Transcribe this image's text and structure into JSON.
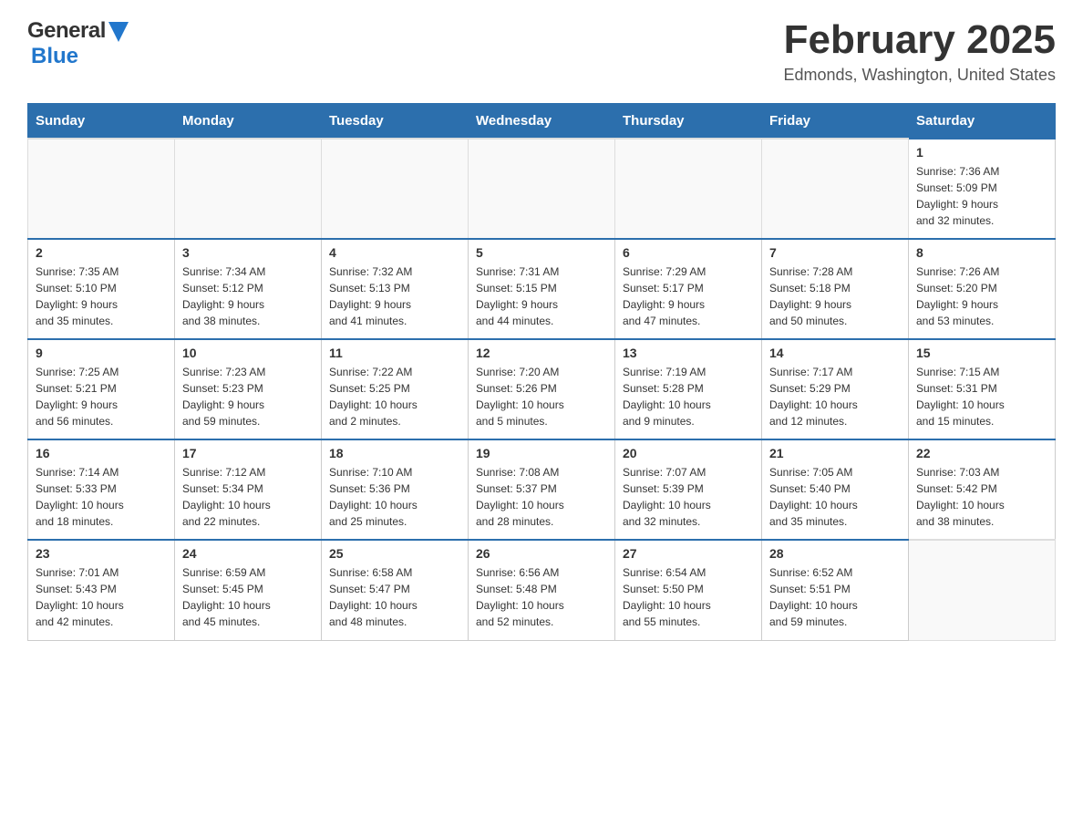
{
  "header": {
    "logo_general": "General",
    "logo_blue": "Blue",
    "month_title": "February 2025",
    "location": "Edmonds, Washington, United States"
  },
  "weekdays": [
    "Sunday",
    "Monday",
    "Tuesday",
    "Wednesday",
    "Thursday",
    "Friday",
    "Saturday"
  ],
  "weeks": [
    [
      {
        "day": "",
        "info": ""
      },
      {
        "day": "",
        "info": ""
      },
      {
        "day": "",
        "info": ""
      },
      {
        "day": "",
        "info": ""
      },
      {
        "day": "",
        "info": ""
      },
      {
        "day": "",
        "info": ""
      },
      {
        "day": "1",
        "info": "Sunrise: 7:36 AM\nSunset: 5:09 PM\nDaylight: 9 hours\nand 32 minutes."
      }
    ],
    [
      {
        "day": "2",
        "info": "Sunrise: 7:35 AM\nSunset: 5:10 PM\nDaylight: 9 hours\nand 35 minutes."
      },
      {
        "day": "3",
        "info": "Sunrise: 7:34 AM\nSunset: 5:12 PM\nDaylight: 9 hours\nand 38 minutes."
      },
      {
        "day": "4",
        "info": "Sunrise: 7:32 AM\nSunset: 5:13 PM\nDaylight: 9 hours\nand 41 minutes."
      },
      {
        "day": "5",
        "info": "Sunrise: 7:31 AM\nSunset: 5:15 PM\nDaylight: 9 hours\nand 44 minutes."
      },
      {
        "day": "6",
        "info": "Sunrise: 7:29 AM\nSunset: 5:17 PM\nDaylight: 9 hours\nand 47 minutes."
      },
      {
        "day": "7",
        "info": "Sunrise: 7:28 AM\nSunset: 5:18 PM\nDaylight: 9 hours\nand 50 minutes."
      },
      {
        "day": "8",
        "info": "Sunrise: 7:26 AM\nSunset: 5:20 PM\nDaylight: 9 hours\nand 53 minutes."
      }
    ],
    [
      {
        "day": "9",
        "info": "Sunrise: 7:25 AM\nSunset: 5:21 PM\nDaylight: 9 hours\nand 56 minutes."
      },
      {
        "day": "10",
        "info": "Sunrise: 7:23 AM\nSunset: 5:23 PM\nDaylight: 9 hours\nand 59 minutes."
      },
      {
        "day": "11",
        "info": "Sunrise: 7:22 AM\nSunset: 5:25 PM\nDaylight: 10 hours\nand 2 minutes."
      },
      {
        "day": "12",
        "info": "Sunrise: 7:20 AM\nSunset: 5:26 PM\nDaylight: 10 hours\nand 5 minutes."
      },
      {
        "day": "13",
        "info": "Sunrise: 7:19 AM\nSunset: 5:28 PM\nDaylight: 10 hours\nand 9 minutes."
      },
      {
        "day": "14",
        "info": "Sunrise: 7:17 AM\nSunset: 5:29 PM\nDaylight: 10 hours\nand 12 minutes."
      },
      {
        "day": "15",
        "info": "Sunrise: 7:15 AM\nSunset: 5:31 PM\nDaylight: 10 hours\nand 15 minutes."
      }
    ],
    [
      {
        "day": "16",
        "info": "Sunrise: 7:14 AM\nSunset: 5:33 PM\nDaylight: 10 hours\nand 18 minutes."
      },
      {
        "day": "17",
        "info": "Sunrise: 7:12 AM\nSunset: 5:34 PM\nDaylight: 10 hours\nand 22 minutes."
      },
      {
        "day": "18",
        "info": "Sunrise: 7:10 AM\nSunset: 5:36 PM\nDaylight: 10 hours\nand 25 minutes."
      },
      {
        "day": "19",
        "info": "Sunrise: 7:08 AM\nSunset: 5:37 PM\nDaylight: 10 hours\nand 28 minutes."
      },
      {
        "day": "20",
        "info": "Sunrise: 7:07 AM\nSunset: 5:39 PM\nDaylight: 10 hours\nand 32 minutes."
      },
      {
        "day": "21",
        "info": "Sunrise: 7:05 AM\nSunset: 5:40 PM\nDaylight: 10 hours\nand 35 minutes."
      },
      {
        "day": "22",
        "info": "Sunrise: 7:03 AM\nSunset: 5:42 PM\nDaylight: 10 hours\nand 38 minutes."
      }
    ],
    [
      {
        "day": "23",
        "info": "Sunrise: 7:01 AM\nSunset: 5:43 PM\nDaylight: 10 hours\nand 42 minutes."
      },
      {
        "day": "24",
        "info": "Sunrise: 6:59 AM\nSunset: 5:45 PM\nDaylight: 10 hours\nand 45 minutes."
      },
      {
        "day": "25",
        "info": "Sunrise: 6:58 AM\nSunset: 5:47 PM\nDaylight: 10 hours\nand 48 minutes."
      },
      {
        "day": "26",
        "info": "Sunrise: 6:56 AM\nSunset: 5:48 PM\nDaylight: 10 hours\nand 52 minutes."
      },
      {
        "day": "27",
        "info": "Sunrise: 6:54 AM\nSunset: 5:50 PM\nDaylight: 10 hours\nand 55 minutes."
      },
      {
        "day": "28",
        "info": "Sunrise: 6:52 AM\nSunset: 5:51 PM\nDaylight: 10 hours\nand 59 minutes."
      },
      {
        "day": "",
        "info": ""
      }
    ]
  ]
}
